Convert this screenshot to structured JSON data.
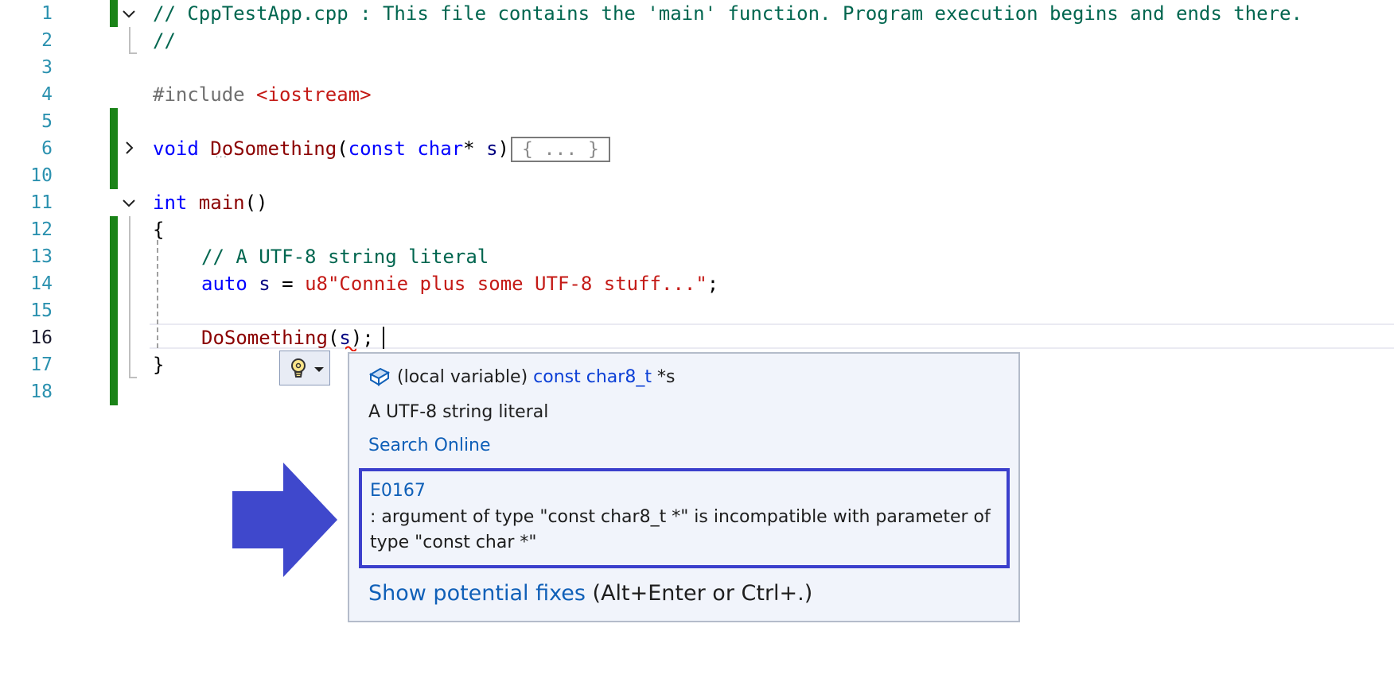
{
  "editor": {
    "lines": [
      {
        "n": "1",
        "segments": [
          {
            "t": "// CppTestApp.cpp : This file contains the 'main' function. Program execution begins and ends there.",
            "c": "cm"
          }
        ]
      },
      {
        "n": "2",
        "segments": [
          {
            "t": "//",
            "c": "cm"
          }
        ]
      },
      {
        "n": "3",
        "segments": []
      },
      {
        "n": "4",
        "segments": [
          {
            "t": "#include ",
            "c": "pp"
          },
          {
            "t": "<iostream>",
            "c": "inc"
          }
        ]
      },
      {
        "n": "5",
        "segments": []
      },
      {
        "n": "6",
        "segments": [
          {
            "t": "void ",
            "c": "kw"
          },
          {
            "t": "DoSomething",
            "c": "fn"
          },
          {
            "t": "(",
            "c": ""
          },
          {
            "t": "const ",
            "c": "kw"
          },
          {
            "t": "char",
            "c": "kw"
          },
          {
            "t": "* ",
            "c": ""
          },
          {
            "t": "s",
            "c": "var"
          },
          {
            "t": ")",
            "c": ""
          }
        ]
      },
      {
        "n": "10",
        "segments": []
      },
      {
        "n": "11",
        "segments": [
          {
            "t": "int ",
            "c": "kw"
          },
          {
            "t": "main",
            "c": "fn"
          },
          {
            "t": "()",
            "c": ""
          }
        ]
      },
      {
        "n": "12",
        "segments": [
          {
            "t": "{",
            "c": ""
          }
        ]
      },
      {
        "n": "13",
        "segments": [
          {
            "t": "// A UTF-8 string literal",
            "c": "cm"
          }
        ]
      },
      {
        "n": "14",
        "segments": [
          {
            "t": "auto ",
            "c": "kw"
          },
          {
            "t": "s",
            "c": "var"
          },
          {
            "t": " = ",
            "c": ""
          },
          {
            "t": "u8\"Connie plus some UTF-8 stuff...\"",
            "c": "str"
          },
          {
            "t": ";",
            "c": ""
          }
        ]
      },
      {
        "n": "15",
        "segments": []
      },
      {
        "n": "16",
        "segments": [
          {
            "t": "DoSomething",
            "c": "fn"
          },
          {
            "t": "(",
            "c": ""
          },
          {
            "t": "s",
            "c": "var"
          },
          {
            "t": ");",
            "c": ""
          }
        ]
      },
      {
        "n": "17",
        "segments": [
          {
            "t": "}",
            "c": ""
          }
        ]
      },
      {
        "n": "18",
        "segments": []
      }
    ],
    "collapsed_label": "{ ... }",
    "active_line": "16"
  },
  "tooltip": {
    "signature_prefix": "(local variable) ",
    "signature_type": "const char8_t",
    "signature_suffix": " *s",
    "description": "A UTF-8 string literal",
    "search_link": "Search Online",
    "error_code": "E0167",
    "error_message": ": argument of type \"const char8_t *\" is incompatible with parameter of type \"const char *\"",
    "fix_link": "Show potential fixes",
    "fix_shortcut": " (Alt+Enter or Ctrl+.)"
  },
  "icons": {
    "fold_expanded": "chevron-down-icon",
    "fold_collapsed": "chevron-right-icon",
    "quick_actions": "lightbulb-icon",
    "variable": "local-variable-icon",
    "callout": "arrow-right-icon"
  },
  "colors": {
    "change_bar": "#1a8317",
    "error_highlight": "#3b3fcc",
    "arrow": "#3f48cc"
  }
}
